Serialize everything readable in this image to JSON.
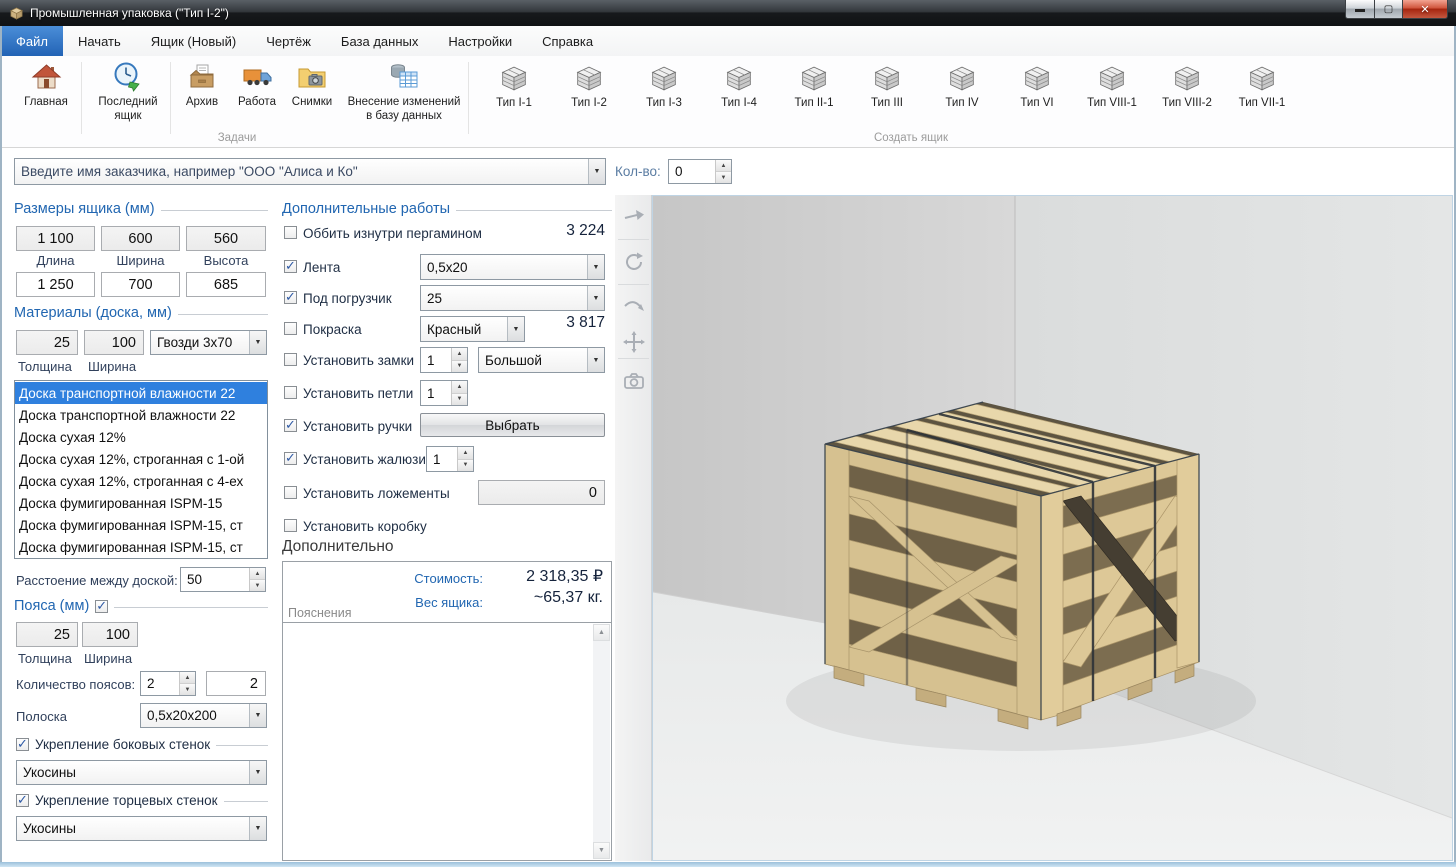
{
  "window": {
    "title": "Промышленная упаковка (\"Тип I-2\")",
    "minimize": "—",
    "maximize": "▢",
    "close": "✕"
  },
  "menu": {
    "items": [
      "Файл",
      "Начать",
      "Ящик (Новый)",
      "Чертёж",
      "База данных",
      "Настройки",
      "Справка"
    ],
    "active": "Файл"
  },
  "toolbar": {
    "tasks": {
      "label": "Задачи",
      "buttons": [
        {
          "label": "Главная",
          "icon": "home-icon"
        },
        {
          "label": "Последний ящик",
          "icon": "clock-icon"
        },
        {
          "label": "Архив",
          "icon": "archive-icon"
        },
        {
          "label": "Работа",
          "icon": "truck-icon"
        },
        {
          "label": "Снимки",
          "icon": "camera-folder-icon"
        },
        {
          "label": "Внесение изменений в базу данных",
          "icon": "database-icon"
        }
      ]
    },
    "create": {
      "label": "Создать ящик",
      "types": [
        "Тип I-1",
        "Тип I-2",
        "Тип I-3",
        "Тип I-4",
        "Тип II-1",
        "Тип III",
        "Тип IV",
        "Тип VI",
        "Тип VIII-1",
        "Тип VIII-2",
        "Тип VII-1"
      ]
    }
  },
  "customer": {
    "placeholder": "Введите имя заказчика, например \"ООО \"Алиса и Ко\"",
    "qty_label": "Кол-во:",
    "qty_value": "0"
  },
  "dimensions": {
    "header": "Размеры ящика (мм)",
    "inner": [
      "1 100",
      "600",
      "560"
    ],
    "labels": [
      "Длина",
      "Ширина",
      "Высота"
    ],
    "outer": [
      "1 250",
      "700",
      "685"
    ]
  },
  "materials": {
    "header": "Материалы (доска, мм)",
    "thickness": "25",
    "width": "100",
    "labels": [
      "Толщина",
      "Ширина"
    ],
    "nails": "Гвозди 3x70",
    "board_list": [
      "Доска транспортной влажности 22",
      "Доска транспортной влажности 22",
      "Доска сухая 12%",
      "Доска сухая 12%, строганная с 1-ой",
      "Доска сухая 12%, строганная с 4-ех",
      "Доска фумигированная ISPM-15",
      "Доска фумигированная ISPM-15, ст",
      "Доска фумигированная ISPM-15, ст"
    ],
    "selected_index": 0
  },
  "spacing": {
    "label": "Расстоение между доской:",
    "value": "50"
  },
  "belts": {
    "header": "Пояса (мм)",
    "checked": true,
    "thickness": "25",
    "width": "100",
    "labels": [
      "Толщина",
      "Ширина"
    ],
    "count_label": "Количество поясов:",
    "count": "2",
    "count2": "2",
    "strip_label": "Полоска",
    "strip_value": "0,5x20x200"
  },
  "side_reinforce": {
    "label": "Укрепление боковых стенок",
    "checked": true,
    "value": "Укосины"
  },
  "end_reinforce": {
    "label": "Укрепление торцевых стенок",
    "checked": true,
    "value": "Укосины"
  },
  "extra_works": {
    "header": "Дополнительные работы",
    "pergamin": {
      "label": "Оббить изнутри пергамином",
      "checked": false,
      "price": "3 224"
    },
    "tape": {
      "label": "Лента",
      "checked": true,
      "value": "0,5x20"
    },
    "forklift": {
      "label": "Под погрузчик",
      "checked": true,
      "value": "25"
    },
    "paint": {
      "label": "Покраска",
      "checked": false,
      "value": "Красный",
      "price": "3 817"
    },
    "locks": {
      "label": "Установить замки",
      "checked": false,
      "count": "1",
      "value": "Большой"
    },
    "hinges": {
      "label": "Установить петли",
      "checked": false,
      "count": "1"
    },
    "handles": {
      "label": "Установить ручки",
      "checked": true,
      "button": "Выбрать"
    },
    "louvers": {
      "label": "Установить жалюзи",
      "checked": true,
      "count": "1"
    },
    "lodgements": {
      "label": "Установить ложементы",
      "checked": false,
      "value": "0"
    },
    "box": {
      "label": "Установить коробку",
      "checked": false
    }
  },
  "summary": {
    "extra_header": "Дополнительно",
    "cost_label": "Стоимость:",
    "cost": "2 318,35 ₽",
    "weight_label": "Вес ящика:",
    "weight": "~65,37 кг.",
    "notes_label": "Пояснения"
  },
  "viewport": {
    "tools": [
      "forward",
      "rotate",
      "orbit",
      "pan",
      "snapshot"
    ]
  },
  "colors": {
    "accent_blue": "#2166b1",
    "selection": "#2f80de",
    "menu_active": "#2263b5",
    "wood": "#d6c190"
  }
}
